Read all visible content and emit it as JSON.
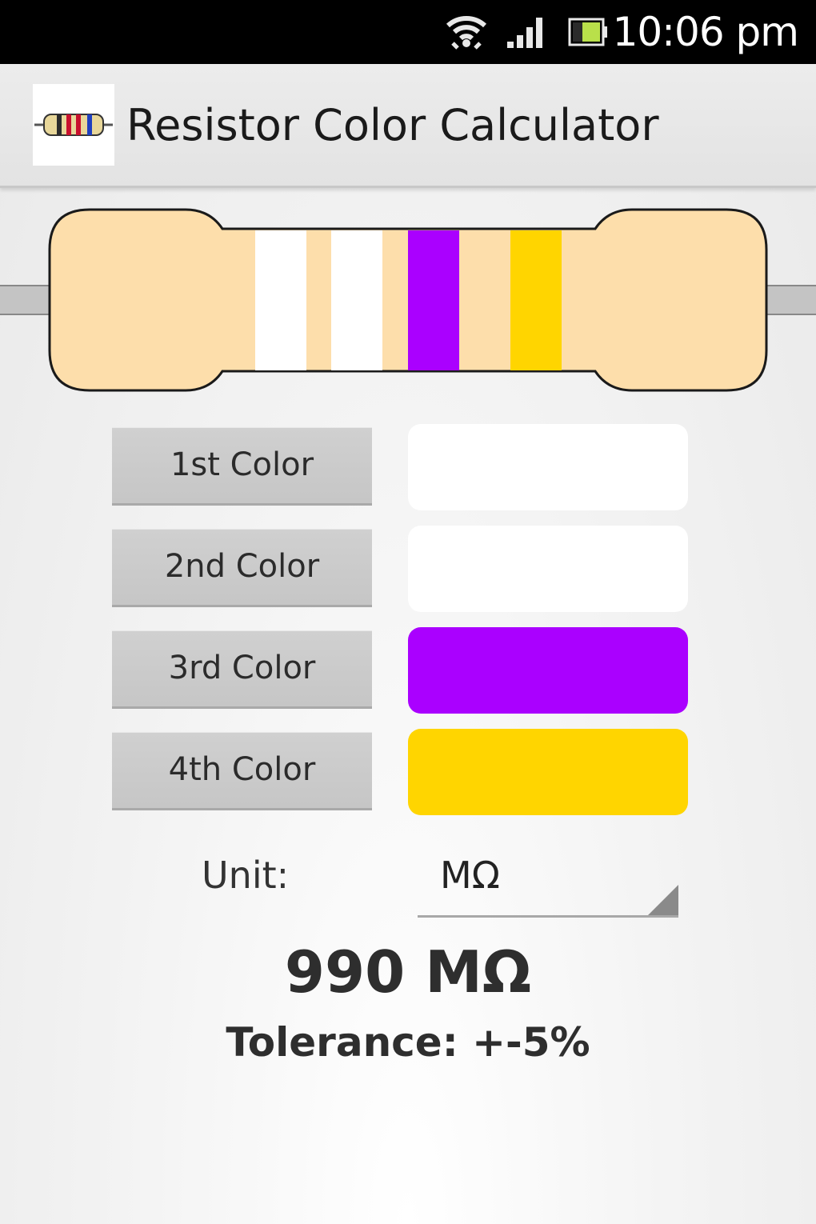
{
  "status_bar": {
    "time": "10:06 pm",
    "icons": [
      "wifi-icon",
      "signal-icon",
      "battery-icon"
    ]
  },
  "action_bar": {
    "title": "Resistor Color Calculator",
    "icon": "resistor-app-icon"
  },
  "colors": {
    "body": "#fddeab",
    "lead": "#c4c4c4",
    "outline": "#1a1a1a"
  },
  "bands": [
    {
      "label": "1st Color",
      "color": "#ffffff"
    },
    {
      "label": "2nd Color",
      "color": "#ffffff"
    },
    {
      "label": "3rd Color",
      "color": "#aa00ff"
    },
    {
      "label": "4th Color",
      "color": "#ffd500"
    }
  ],
  "unit": {
    "label": "Unit:",
    "value": "MΩ"
  },
  "result": {
    "value": "990 MΩ",
    "tolerance": "Tolerance: +-5%"
  }
}
